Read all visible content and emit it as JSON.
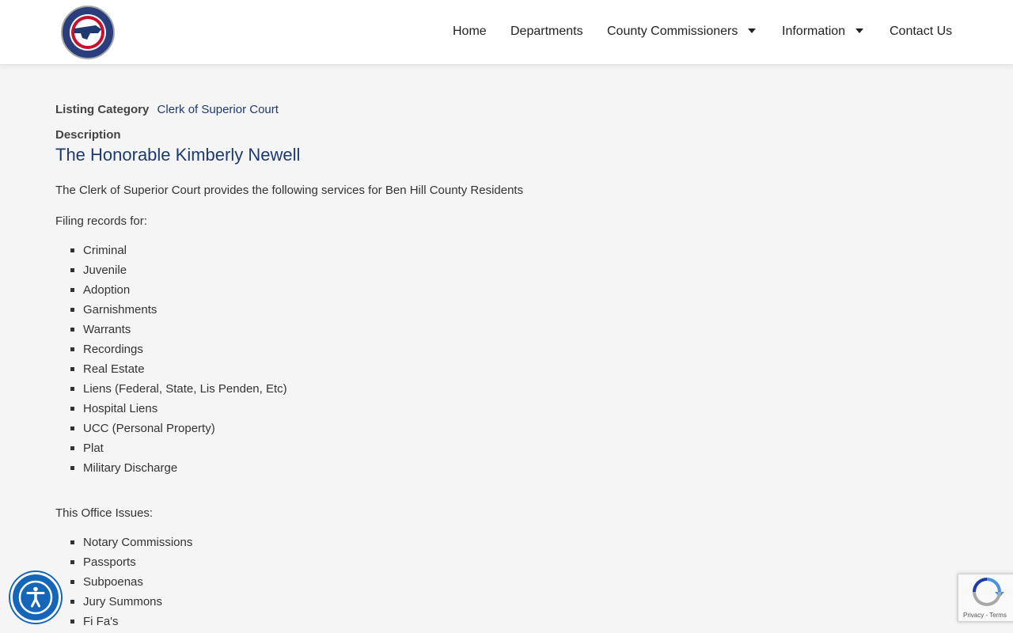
{
  "header": {
    "logo_name": "Ben Hill County Georgia seal",
    "nav": [
      {
        "label": "Home",
        "has_caret": false
      },
      {
        "label": "Departments",
        "has_caret": false
      },
      {
        "label": "County Commissioners",
        "has_caret": true
      },
      {
        "label": "Information",
        "has_caret": true
      },
      {
        "label": "Contact Us",
        "has_caret": false
      }
    ]
  },
  "listing": {
    "category_label": "Listing Category",
    "category_value": "Clerk of Superior Court",
    "description_label": "Description",
    "title": "The Honorable Kimberly Newell",
    "intro": "The Clerk of Superior Court provides the following services for Ben Hill County Residents",
    "filing_heading": "Filing records for:",
    "filing_items": [
      "Criminal",
      "Juvenile",
      "Adoption",
      "Garnishments",
      "Warrants",
      "Recordings",
      "Real Estate",
      "Liens (Federal, State, Lis Penden, Etc)",
      "Hospital Liens",
      "UCC (Personal Property)",
      "Plat",
      "Military Discharge"
    ],
    "issues_heading": "This Office Issues:",
    "issues_items": [
      "Notary Commissions",
      "Passports",
      "Subpoenas",
      "Jury Summons",
      "Fi Fa's"
    ]
  },
  "recaptcha": {
    "links": "Privacy - Terms"
  },
  "colors": {
    "link": "#1f3a70",
    "accessibility_button": "#1565b8"
  }
}
